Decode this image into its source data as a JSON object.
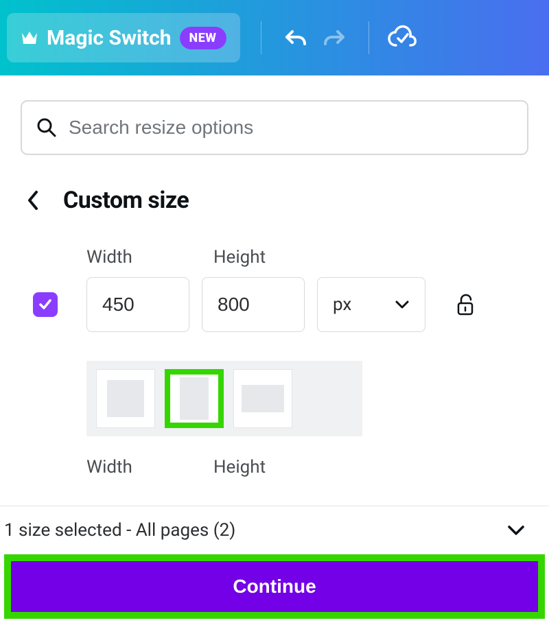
{
  "toolbar": {
    "magic_switch_label": "Magic Switch",
    "new_badge": "NEW"
  },
  "search": {
    "placeholder": "Search resize options"
  },
  "heading": "Custom size",
  "size": {
    "width_label": "Width",
    "height_label": "Height",
    "width_value": "450",
    "height_value": "800",
    "unit": "px"
  },
  "size2": {
    "width_label": "Width",
    "height_label": "Height"
  },
  "footer": {
    "summary": "1 size selected - All pages (2)",
    "continue_label": "Continue"
  },
  "colors": {
    "accent_purple": "#8b3dff",
    "highlight_green": "#35d600",
    "primary_button": "#7300e6"
  }
}
